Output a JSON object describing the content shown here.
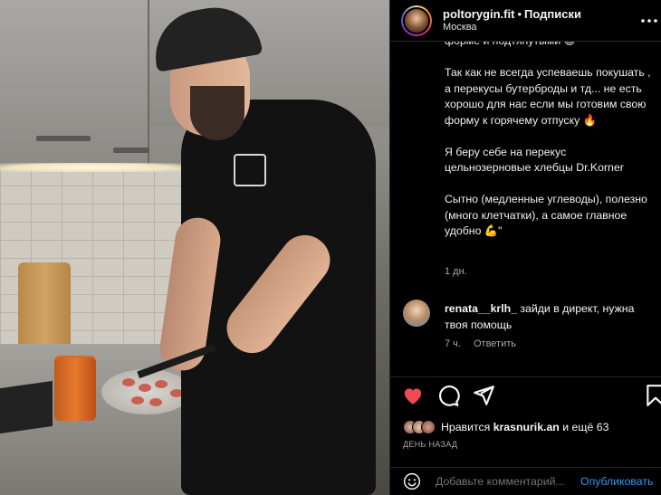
{
  "header": {
    "username": "poltorygin.fit",
    "dot": "•",
    "follow_label": "Подписки",
    "location": "Москва",
    "more_icon": "more-horizontal-icon"
  },
  "caption": {
    "paragraphs": [
      "форме и подтянутыми 😉",
      "Так как не всегда успеваешь покушать , а перекусы бутерброды и тд... не есть хорошо для нас если мы готовим свою форму к горячему отпуску 🔥",
      "Я беру себе на перекус цельнозерновые хлебцы Dr.Korner",
      "Сытно (медленные углеводы), полезно (много клетчатки), а самое главное удобно 💪\""
    ],
    "time": "1 дн."
  },
  "comment": {
    "username": "renata__krlh_",
    "text": "зайди в директ, нужна твоя помощь",
    "time": "7 ч.",
    "reply_label": "Ответить"
  },
  "actions": {
    "like_icon": "heart-filled-icon",
    "comment_icon": "comment-icon",
    "share_icon": "send-icon",
    "save_icon": "bookmark-icon",
    "like_color": "#ed4956"
  },
  "likes": {
    "prefix": "Нравится",
    "user": "krasnurik.an",
    "suffix": "и ещё 63"
  },
  "date": "ДЕНЬ НАЗАД",
  "add_comment": {
    "placeholder": "Добавьте комментарий...",
    "publish_label": "Опубликовать",
    "publish_color": "#3897f0"
  }
}
